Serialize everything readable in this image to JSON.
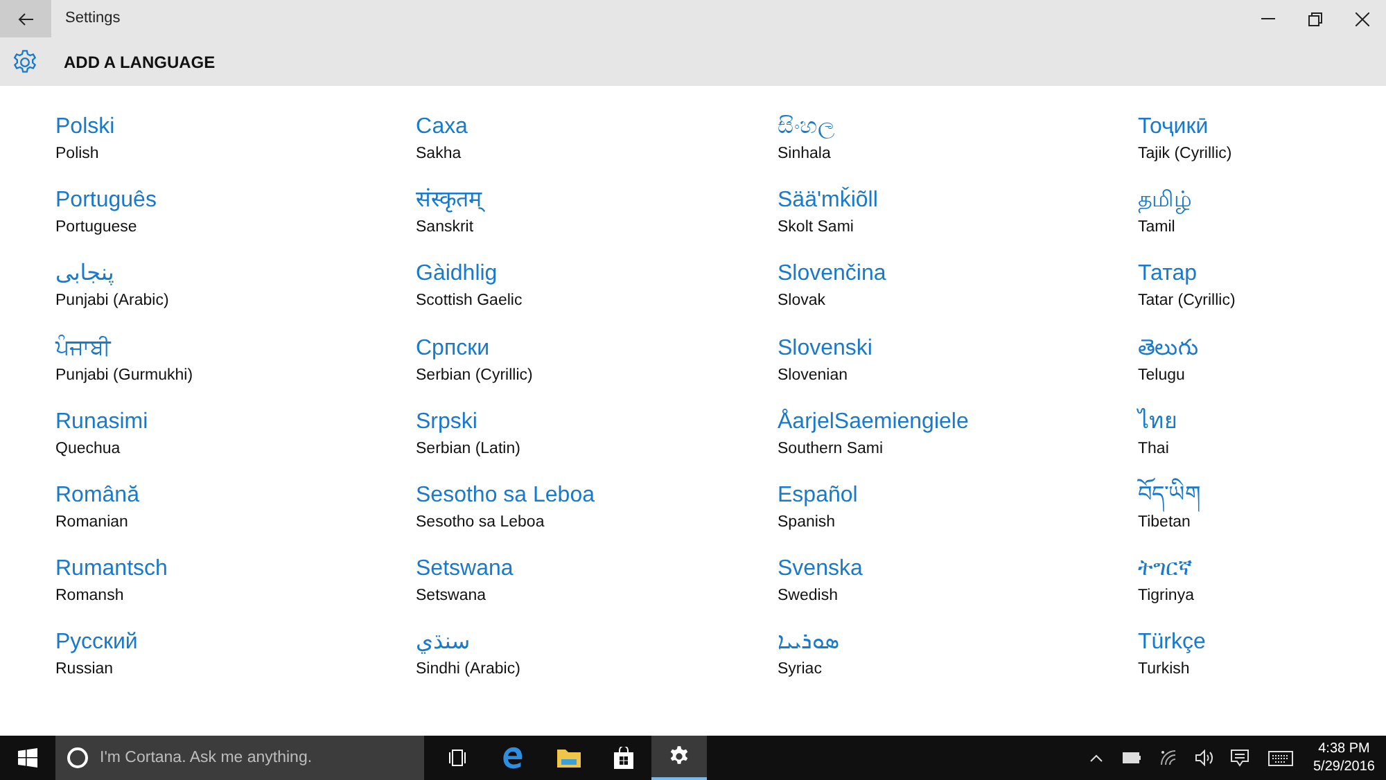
{
  "window": {
    "title": "Settings"
  },
  "header": {
    "title": "ADD A LANGUAGE"
  },
  "languages": [
    {
      "native": "Polski",
      "english": "Polish"
    },
    {
      "native": "Português",
      "english": "Portuguese"
    },
    {
      "native": "پنجابی",
      "english": "Punjabi (Arabic)"
    },
    {
      "native": "ਪੰਜਾਬੀ",
      "english": "Punjabi (Gurmukhi)"
    },
    {
      "native": "Runasimi",
      "english": "Quechua"
    },
    {
      "native": "Română",
      "english": "Romanian"
    },
    {
      "native": "Rumantsch",
      "english": "Romansh"
    },
    {
      "native": "Русский",
      "english": "Russian"
    },
    {
      "native": "Саха",
      "english": "Sakha"
    },
    {
      "native": "संस्कृतम्",
      "english": "Sanskrit"
    },
    {
      "native": "Gàidhlig",
      "english": "Scottish Gaelic"
    },
    {
      "native": "Српски",
      "english": "Serbian (Cyrillic)"
    },
    {
      "native": "Srpski",
      "english": "Serbian (Latin)"
    },
    {
      "native": "Sesotho sa Leboa",
      "english": "Sesotho sa Leboa"
    },
    {
      "native": "Setswana",
      "english": "Setswana"
    },
    {
      "native": "سنڌي",
      "english": "Sindhi (Arabic)"
    },
    {
      "native": "සිංහල",
      "english": "Sinhala"
    },
    {
      "native": "Sääʹmǩiõll",
      "english": "Skolt Sami"
    },
    {
      "native": "Slovenčina",
      "english": "Slovak"
    },
    {
      "native": "Slovenski",
      "english": "Slovenian"
    },
    {
      "native": "ÅarjelSaemiengiele",
      "english": "Southern Sami"
    },
    {
      "native": "Español",
      "english": "Spanish"
    },
    {
      "native": "Svenska",
      "english": "Swedish"
    },
    {
      "native": "ܣܘܪܝܝܐ",
      "english": "Syriac"
    },
    {
      "native": "Тоҷикӣ",
      "english": "Tajik (Cyrillic)"
    },
    {
      "native": "தமிழ்",
      "english": "Tamil"
    },
    {
      "native": "Татар",
      "english": "Tatar (Cyrillic)"
    },
    {
      "native": "తెలుగు",
      "english": "Telugu"
    },
    {
      "native": "ไทย",
      "english": "Thai"
    },
    {
      "native": "བོད་ཡིག",
      "english": "Tibetan"
    },
    {
      "native": "ትግርኛ",
      "english": "Tigrinya"
    },
    {
      "native": "Türkçe",
      "english": "Turkish"
    }
  ],
  "taskbar": {
    "search": {
      "placeholder": "I'm Cortana. Ask me anything."
    },
    "apps": [
      {
        "kind": "taskview",
        "selected": false
      },
      {
        "kind": "browser",
        "selected": false
      },
      {
        "kind": "folder",
        "selected": false
      },
      {
        "kind": "store",
        "selected": false
      },
      {
        "kind": "settings",
        "selected": true
      }
    ],
    "clock": {
      "time": "4:38 PM",
      "date": "5/29/2016"
    }
  }
}
